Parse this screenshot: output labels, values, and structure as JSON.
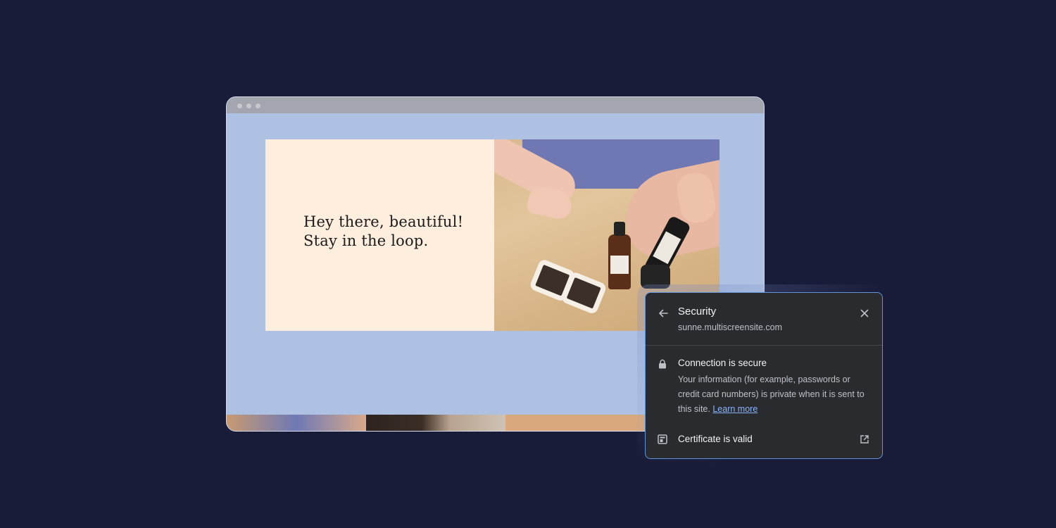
{
  "website": {
    "hero_line1": "Hey there, beautiful!",
    "hero_line2": "Stay in the loop."
  },
  "security_popup": {
    "title": "Security",
    "site_url": "sunne.multiscreensite.com",
    "connection_title": "Connection is secure",
    "connection_text": "Your information (for example, passwords or credit card numbers) is private when it is sent to this site.",
    "learn_more_label": "Learn more",
    "certificate_label": "Certificate is valid",
    "icons": [
      "back-arrow-icon",
      "close-icon",
      "lock-icon",
      "certificate-icon",
      "external-link-icon"
    ]
  },
  "colors": {
    "page_background": "#191c38",
    "browser_canvas": "#aec1e2",
    "hero_card": "#fdeedd",
    "popup_background": "#2a2b2f",
    "popup_border": "#5f95d6",
    "link": "#8ab4f8"
  }
}
